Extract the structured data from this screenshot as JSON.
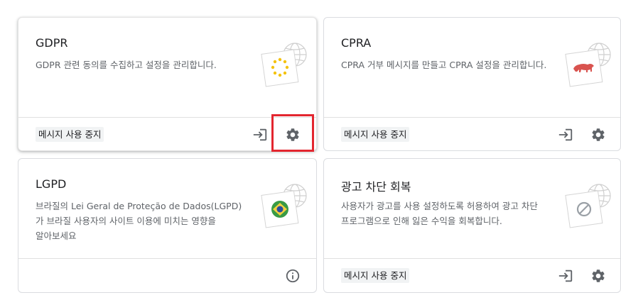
{
  "cards": [
    {
      "title": "GDPR",
      "description": "GDPR 관련 동의를 수집하고 설정을 관리합니다.",
      "status": "메시지 사용 중지",
      "illustration": "eu-stars-icon"
    },
    {
      "title": "CPRA",
      "description": "CPRA 거부 메시지를 만들고 CPRA 설정을 관리합니다.",
      "status": "메시지 사용 중지",
      "illustration": "california-bear-icon"
    },
    {
      "title": "LGPD",
      "description": "브라질의 Lei Geral de Proteção de Dados(LGPD)가 브라질 사용자의 사이트 이용에 미치는 영향을 알아보세요",
      "illustration": "brazil-flag-icon"
    },
    {
      "title": "광고 차단 회복",
      "description": "사용자가 광고를 사용 설정하도록 허용하여 광고 차단 프로그램으로 인해 잃은 수익을 회복합니다.",
      "status": "메시지 사용 중지",
      "illustration": "no-entry-icon"
    }
  ],
  "colors": {
    "highlight": "#e3262f",
    "icon": "#5f6368",
    "border": "#dadce0",
    "eu_star": "#f4c20d",
    "bear": "#d9534f",
    "brazil_green": "#3a9b45",
    "brazil_yellow": "#f4d03f",
    "brazil_blue": "#2a4d9c"
  }
}
